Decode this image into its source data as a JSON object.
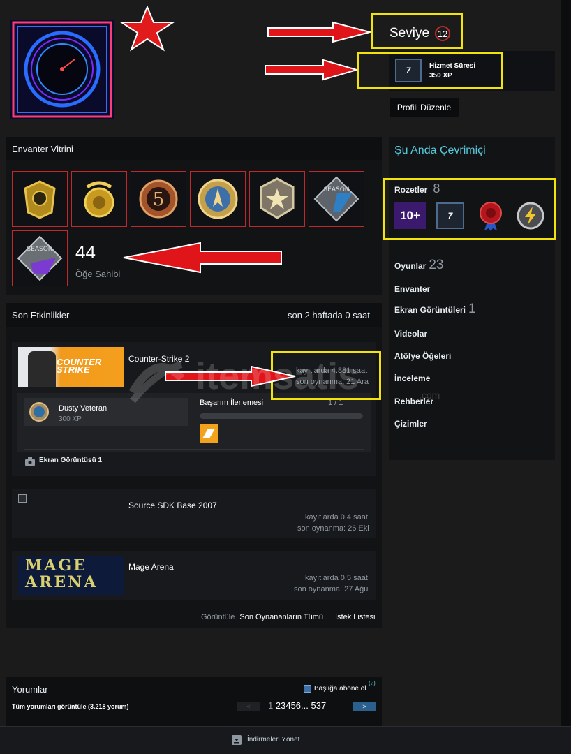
{
  "profile": {
    "level_label": "Seviye",
    "level_value": "12",
    "xp_badge_name": "Hizmet Süresi",
    "xp_badge_xp": "350 XP",
    "badge_number": "7",
    "edit_button": "Profili Düzenle",
    "status": "Şu Anda Çevrimiçi"
  },
  "inventory": {
    "title": "Envanter Vitrini",
    "count": "44",
    "count_label": "Öğe Sahibi",
    "items": [
      "gold-emblem",
      "gold-coin-snake",
      "five-year-coin",
      "operation-coin",
      "star-medal",
      "season-medal-1",
      "season-medal-2"
    ]
  },
  "badges": {
    "label": "Rozetler",
    "count": "8",
    "items": [
      "10+",
      "7",
      "seal",
      "lightning"
    ]
  },
  "sidebar_links": [
    {
      "label": "Oyunlar",
      "count": "23"
    },
    {
      "label": "Envanter",
      "count": ""
    },
    {
      "label": "Ekran Görüntüleri",
      "count": "1"
    },
    {
      "label": "Videolar",
      "count": ""
    },
    {
      "label": "Atölye Öğeleri",
      "count": ""
    },
    {
      "label": "İnceleme",
      "count": ""
    },
    {
      "label": "Rehberler",
      "count": ""
    },
    {
      "label": "Çizimler",
      "count": ""
    }
  ],
  "recent": {
    "title": "Son Etkinlikler",
    "summary": "son 2 haftada 0 saat",
    "games": [
      {
        "name": "Counter-Strike 2",
        "hours": "kayıtlarda 4.881 saat",
        "last": "son oynanma: 21 Ara"
      },
      {
        "name": "Source SDK Base 2007",
        "hours": "kayıtlarda 0,4 saat",
        "last": "son oynanma: 26 Eki"
      },
      {
        "name": "Mage Arena",
        "hours": "kayıtlarda 0,5 saat",
        "last": "son oynanma: 27 Ağu"
      }
    ],
    "achievement_name": "Dusty Veteran",
    "achievement_xp": "300 XP",
    "progress_label": "Başarım İlerlemesi",
    "progress_value": "1 / 1",
    "progress_fraction": 1,
    "screenshot_label": "Ekran Görüntüsü 1",
    "view_label": "Görüntüle",
    "view_all": "Son Oynananların Tümü",
    "wishlist": "İstek Listesi",
    "cs2_logo_line1": "COUNTER",
    "cs2_logo_line2": "STRIKE",
    "mage_logo_line1": "MAGE",
    "mage_logo_line2": "ARENA"
  },
  "watermark": {
    "brand": "itemsatis",
    "sub": ".com"
  },
  "comments": {
    "title": "Yorumlar",
    "subscribe": "Başlığa abone ol",
    "help": "(?)",
    "view_all": "Tüm yorumları görüntüle (3.218 yorum)",
    "pages": [
      "1",
      "2",
      "3",
      "4",
      "5",
      "6",
      "...",
      "537"
    ]
  },
  "footer": {
    "downloads": "İndirmeleri Yönet"
  },
  "colors": {
    "accent_red": "#d9191c",
    "highlight_yellow": "#f2e40a",
    "online_blue": "#57cbde",
    "level_ring": "#c02a2a"
  }
}
